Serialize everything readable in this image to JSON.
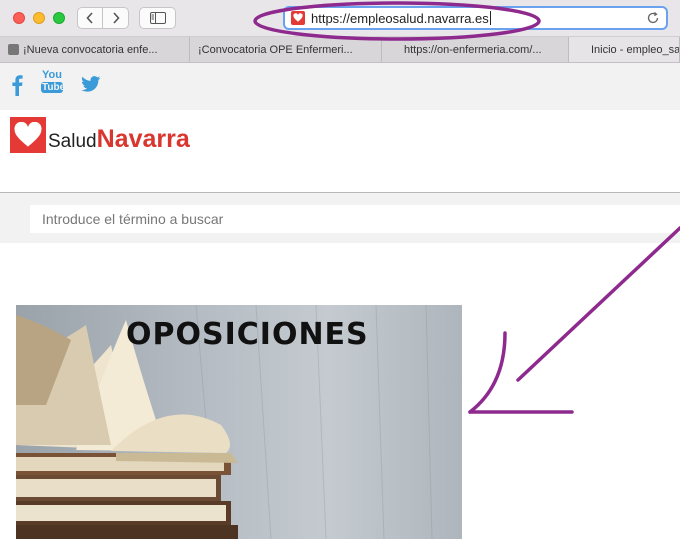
{
  "browser": {
    "url": "https://empleosalud.navarra.es",
    "tabs": [
      {
        "label": "¡Nueva convocatoria enfe..."
      },
      {
        "label": "¡Convocatoria OPE Enfermeri..."
      },
      {
        "label": "https://on-enfermeria.com/..."
      },
      {
        "label": "Inicio - empleo_sa"
      }
    ]
  },
  "social": {
    "icons": [
      "facebook-icon",
      "youtube-icon",
      "twitter-icon"
    ],
    "youtube_label_top": "You",
    "youtube_label_bottom": "Tube"
  },
  "header": {
    "logo_prefix": "Salud",
    "logo_suffix": "Navarra"
  },
  "search": {
    "placeholder": "Introduce el término a buscar"
  },
  "banner": {
    "title": "OPOSICIONES"
  },
  "colors": {
    "brand_red": "#d8362e",
    "annotation_purple": "#8e2a8e",
    "social_blue": "#3b9bd8"
  }
}
